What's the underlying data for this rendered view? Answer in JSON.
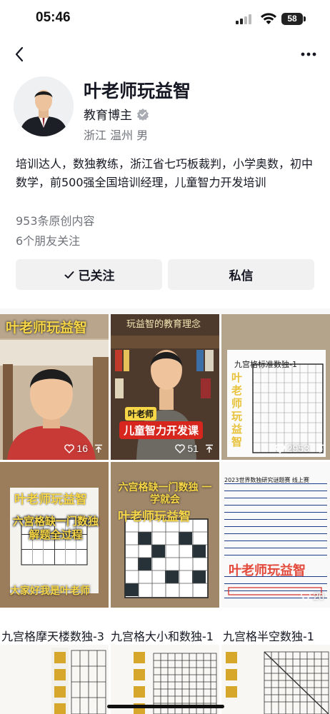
{
  "status_bar": {
    "time": "05:46",
    "battery": "58"
  },
  "nav": {
    "back_icon": "chevron-left-icon",
    "more_icon": "ellipsis-icon"
  },
  "profile": {
    "name": "叶老师玩益智",
    "role": "教育博主",
    "location_gender": "浙江 温州 男",
    "bio": "培训达人，数独教练，浙江省七巧板裁判，小学奥数，初中数学，前500强全国培训经理，儿童智力开发培训",
    "original_count": "953条原创内容",
    "friends_following": "6个朋友关注"
  },
  "actions": {
    "follow_label": "已关注",
    "message_label": "私信"
  },
  "videos": [
    {
      "title_overlay": "叶老师玩益智",
      "banner": "",
      "caption": "",
      "likes": "16"
    },
    {
      "title_overlay": "玩益智的教育理念",
      "banner": "儿童智力开发课",
      "caption": "叶老师",
      "likes": "51"
    },
    {
      "title_overlay": "九宫格标准数独-1",
      "banner": "叶老师玩益智",
      "caption": "",
      "likes": "2953"
    },
    {
      "title_overlay": "叶老师玩益智",
      "banner": "六宫格缺一门数独 解题全过程",
      "caption": "大家好我是叶老师",
      "likes": ""
    },
    {
      "title_overlay": "六宫格缺一门数独 一学就会",
      "banner": "叶老师玩益智",
      "caption": "",
      "likes": ""
    },
    {
      "title_overlay": "2023世界数独研究谜题赛 线上赛",
      "banner": "叶老师玩益智",
      "caption": "",
      "likes": "20"
    }
  ],
  "bottom_captions": [
    "九宫格摩天楼数独-3",
    "九宫格大小和数独-1",
    "九宫格半空数独-1"
  ],
  "colors": {
    "accent_yellow": "#f7d748",
    "brand_red": "#d7261e",
    "muted_text": "#70737a",
    "button_bg": "#f1f1f2"
  }
}
